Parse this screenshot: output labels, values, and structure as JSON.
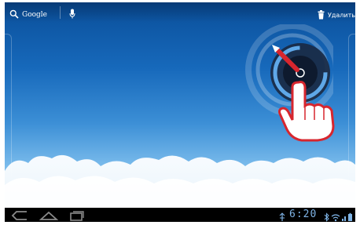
{
  "top_bar": {
    "search_label": "Google",
    "delete_label": "Удалить"
  },
  "system_bar": {
    "clock": "6:20"
  },
  "colors": {
    "sky_top": "#0a4f9a",
    "sky_bottom": "#cfe7f8",
    "nav_bar": "#000000",
    "clock_color": "#7fb4e6",
    "pointer_red": "#d7262e",
    "dial_dark": "#1a2a44"
  },
  "icons": {
    "search": "search-icon",
    "mic": "microphone-icon",
    "delete": "trash-icon",
    "back": "back-icon",
    "home": "home-icon",
    "recent": "recent-apps-icon",
    "touch": "touch-hand-icon",
    "dial": "gesture-dial-icon"
  }
}
